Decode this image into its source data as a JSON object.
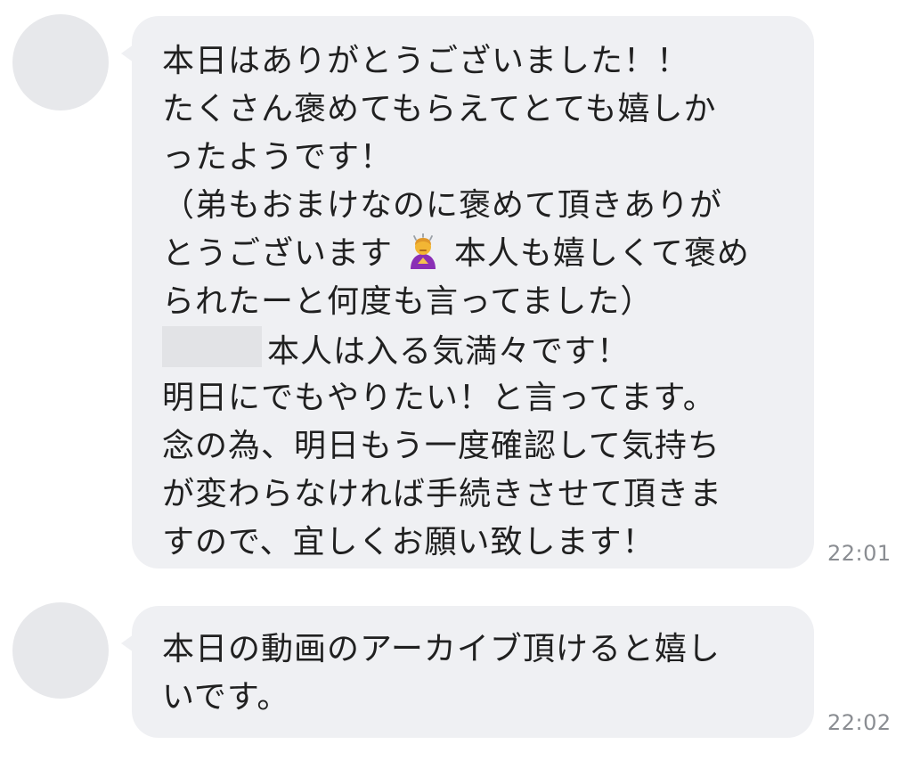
{
  "messages": [
    {
      "lines": [
        "本日はありがとうございました！！",
        "たくさん褒めてもらえてとても嬉しか",
        "ったようです！",
        "（弟もおまけなのに褒めて頂きありが",
        "とうございます",
        "本人も嬉しくて褒め",
        "られたーと何度も言ってました）",
        "本人は入る気満々です！",
        "明日にでもやりたい！と言ってます。",
        "念の為、明日もう一度確認して気持ち",
        "が変わらなければ手続きさせて頂きま",
        "すので、宜しくお願い致します！"
      ],
      "emoji": "person-bowing-emoji",
      "time": "22:01"
    },
    {
      "lines": [
        "本日の動画のアーカイブ頂けると嬉し",
        "いです。"
      ],
      "time": "22:02"
    }
  ],
  "colors": {
    "bubble": "#eff0f3",
    "avatar": "#e7e8eb",
    "text": "#202020",
    "time": "#8a8d92"
  }
}
